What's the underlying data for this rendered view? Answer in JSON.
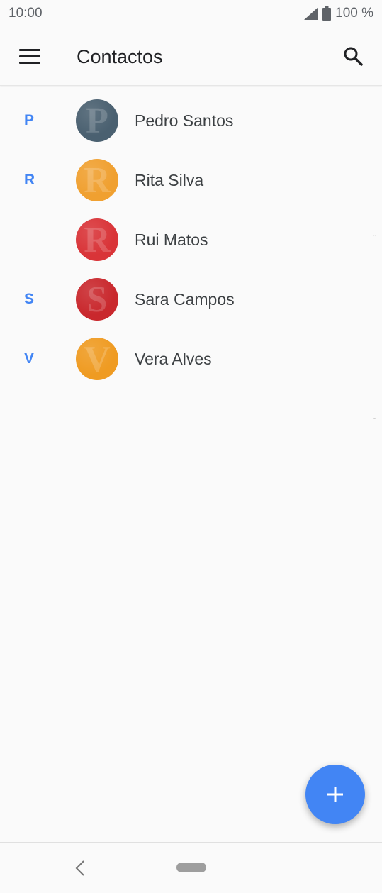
{
  "status": {
    "time": "10:00",
    "battery": "100 %"
  },
  "header": {
    "title": "Contactos"
  },
  "contacts": [
    {
      "letter": "P",
      "name": "Pedro Santos",
      "initial": "P",
      "color": "#4a6070"
    },
    {
      "letter": "R",
      "name": "Rita Silva",
      "initial": "R",
      "color": "#f0a030"
    },
    {
      "letter": "",
      "name": "Rui Matos",
      "initial": "R",
      "color": "#d93438"
    },
    {
      "letter": "S",
      "name": "Sara Campos",
      "initial": "S",
      "color": "#c9282d"
    },
    {
      "letter": "V",
      "name": "Vera Alves",
      "initial": "V",
      "color": "#ef9b22"
    }
  ],
  "colors": {
    "accent": "#4285f4"
  },
  "icons": {
    "menu": "menu-icon",
    "search": "search-icon",
    "add": "plus-icon",
    "back": "back-icon"
  }
}
